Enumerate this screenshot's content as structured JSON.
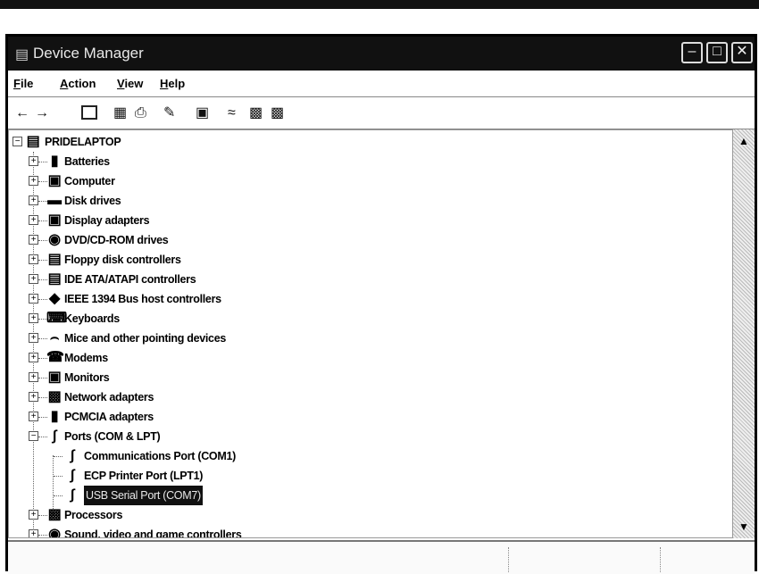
{
  "window": {
    "title": "Device Manager",
    "title_icon": "device-manager-icon"
  },
  "menu": [
    {
      "label": "File",
      "key": "F",
      "rest": "ile"
    },
    {
      "label": "Action",
      "key": "A",
      "rest": "ction"
    },
    {
      "label": "View",
      "key": "V",
      "rest": "iew"
    },
    {
      "label": "Help",
      "key": "H",
      "rest": "elp"
    }
  ],
  "toolbar": [
    "back-arrow-icon",
    "forward-arrow-icon",
    "view-icon",
    "properties-icon",
    "print-icon",
    "help-icon",
    "scan-hardware-icon",
    "uninstall-icon",
    "disable-icon",
    "update-driver-icon"
  ],
  "tree": {
    "root": "PRIDELAPTOP",
    "categories": [
      "Batteries",
      "Computer",
      "Disk drives",
      "Display adapters",
      "DVD/CD-ROM drives",
      "Floppy disk controllers",
      "IDE ATA/ATAPI controllers",
      "IEEE 1394 Bus host controllers",
      "Keyboards",
      "Mice and other pointing devices",
      "Modems",
      "Monitors",
      "Network adapters",
      "PCMCIA adapters",
      "Ports (COM & LPT)"
    ],
    "ports_children": [
      "Communications Port (COM1)",
      "ECP Printer Port (LPT1)",
      "USB Serial Port (COM7)"
    ],
    "after": [
      "Processors",
      "Sound, video and game controllers"
    ]
  }
}
